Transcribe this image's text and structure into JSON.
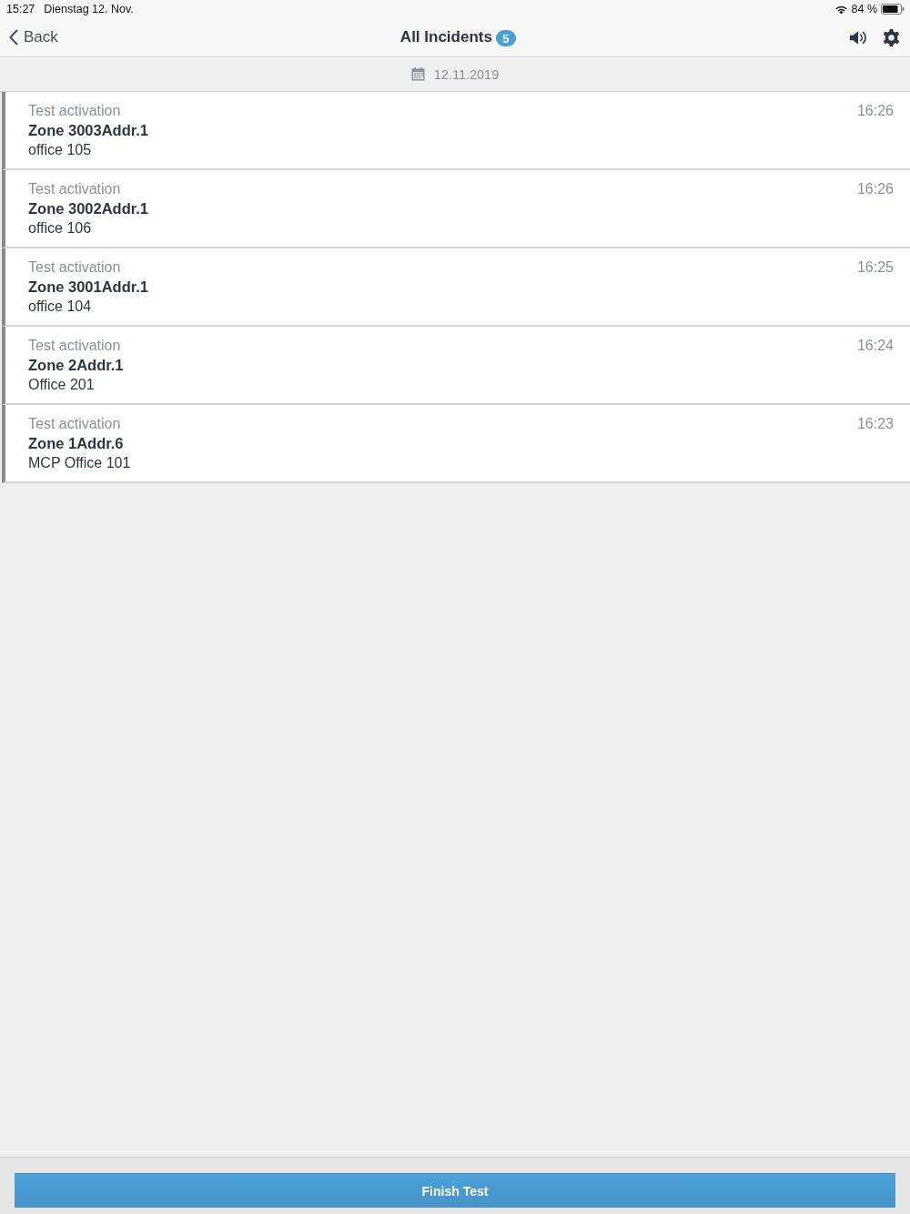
{
  "status_bar": {
    "time": "15:27",
    "date": "Dienstag 12. Nov.",
    "battery": "84 %"
  },
  "nav_bar": {
    "back": "Back",
    "title": "All Incidents",
    "badge": "5"
  },
  "date_header": {
    "date": "12.11.2019"
  },
  "incidents": [
    {
      "type": "Test activation",
      "zone": "Zone 3003Addr.1",
      "location": "office 105",
      "time": "16:26"
    },
    {
      "type": "Test activation",
      "zone": "Zone 3002Addr.1",
      "location": "office 106",
      "time": "16:26"
    },
    {
      "type": "Test activation",
      "zone": "Zone 3001Addr.1",
      "location": "office 104",
      "time": "16:25"
    },
    {
      "type": "Test activation",
      "zone": "Zone 2Addr.1",
      "location": "Office 201",
      "time": "16:24"
    },
    {
      "type": "Test activation",
      "zone": "Zone 1Addr.6",
      "location": "MCP Office 101",
      "time": "16:23"
    }
  ],
  "footer": {
    "button": "Finish Test"
  }
}
